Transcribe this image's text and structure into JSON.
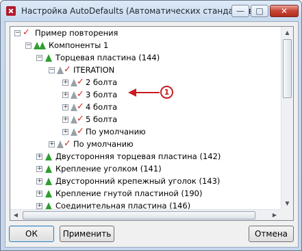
{
  "window": {
    "title": "Настройка AutoDefaults (Автоматических стандартов)"
  },
  "controls": {
    "minimize": "—",
    "maximize": "□",
    "close": "✕"
  },
  "tree": {
    "items": [
      {
        "label": "Пример повторения"
      },
      {
        "label": "Компоненты 1"
      },
      {
        "label": "Торцевая пластина (144)"
      },
      {
        "label": "ITERATION"
      },
      {
        "label": "2 болта"
      },
      {
        "label": "3 болта"
      },
      {
        "label": "4 болта"
      },
      {
        "label": "5 болта"
      },
      {
        "label": "По умолчанию"
      },
      {
        "label": "По умолчанию"
      },
      {
        "label": "Двусторонняя торцевая пластина (142)"
      },
      {
        "label": "Крепление уголком (141)"
      },
      {
        "label": "Двусторонний крепежный уголок (143)"
      },
      {
        "label": "Крепление гнутой пластиной (190)"
      },
      {
        "label": "Соединительная пластина (146)"
      }
    ]
  },
  "callout": {
    "number": "1"
  },
  "buttons": {
    "ok": "ОК",
    "apply": "Применить",
    "cancel": "Отмена"
  },
  "colors": {
    "accent_red": "#c71c22",
    "node_green": "#2f9e2f"
  }
}
